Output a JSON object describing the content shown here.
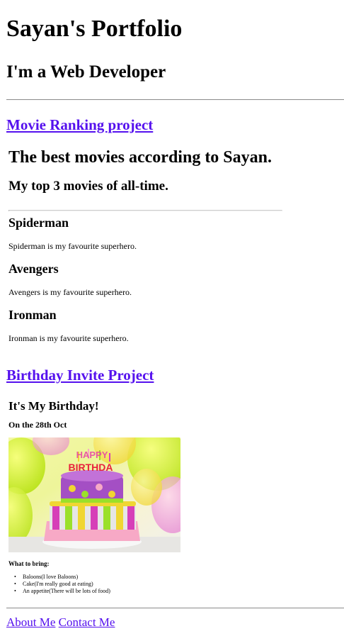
{
  "header": {
    "title": "Sayan's Portfolio",
    "subtitle": "I'm a Web Developer"
  },
  "movie_project": {
    "link_label": "Movie Ranking project",
    "title": "The best movies according to Sayan.",
    "subtitle": "My top 3 movies of all-time.",
    "movies": [
      {
        "name": "Spiderman",
        "description": "Spiderman is my favourite superhero."
      },
      {
        "name": "Avengers",
        "description": "Avengers is my favourite superhero."
      },
      {
        "name": "Ironman",
        "description": "Ironman is my favourite superhero."
      }
    ]
  },
  "birthday_project": {
    "link_label": "Birthday Invite Project",
    "title": "It's My Birthday!",
    "subtitle": "On the 28th Oct",
    "image": {
      "topper_happy": "HAPPY",
      "topper_birthday": "BIRTHDA"
    },
    "bring_heading": "What to bring:",
    "bring_items": [
      "Baloons(I love Baloons)",
      "Cake(I'm really good at eating)",
      "An appetite(There will be lots of food)"
    ]
  },
  "footer": {
    "about_label": "About Me",
    "contact_label": "Contact Me"
  },
  "colors": {
    "link": "#5511ee",
    "rule": "#8a8a8a"
  }
}
